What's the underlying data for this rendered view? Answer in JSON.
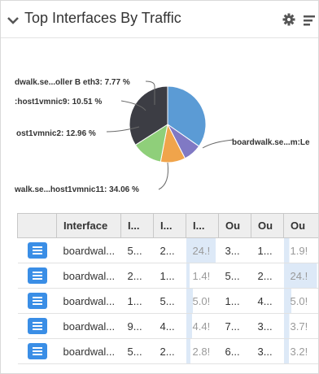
{
  "widget": {
    "title": "Top Interfaces By Traffic"
  },
  "pie": {
    "labels": [
      "boardwalk.se...m:Le",
      "dwalk.se...oller B eth3: 7.77 %",
      ":host1vmnic9: 10.51 %",
      "ost1vmnic2: 12.96 %",
      "walk.se...host1vmnic11: 34.06 %"
    ],
    "slices": [
      {
        "name": "boardwalk.se...m:Le",
        "value": 34.7,
        "color": "#5b9bd5"
      },
      {
        "name": "dwalk.se...oller B eth3",
        "value": 7.77,
        "color": "#8079c4"
      },
      {
        "name": ":host1vmnic9",
        "value": 10.51,
        "color": "#f0a44b"
      },
      {
        "name": "ost1vmnic2",
        "value": 12.96,
        "color": "#8fcf7a"
      },
      {
        "name": "walk.se...host1vmnic11",
        "value": 34.06,
        "color": "#3c3d44"
      }
    ]
  },
  "table": {
    "columns": [
      "",
      "Interface",
      "I...",
      "I...",
      "I...",
      "Ou",
      "Ou",
      "Ou"
    ],
    "rows": [
      {
        "cells": [
          "boardwal...",
          "5...",
          "2...",
          "24.!",
          "3...",
          "1...",
          "1.9!"
        ],
        "bar1": 0.9,
        "bar2": 0.15
      },
      {
        "cells": [
          "boardwal...",
          "2...",
          "1...",
          "1.4!",
          "5...",
          "2...",
          "24.!"
        ],
        "bar1": 0.1,
        "bar2": 0.9
      },
      {
        "cells": [
          "boardwal...",
          "1...",
          "5...",
          "5.0!",
          "1...",
          "4...",
          "5.0!"
        ],
        "bar1": 0.2,
        "bar2": 0.2
      },
      {
        "cells": [
          "boardwal...",
          "9...",
          "4...",
          "4.4!",
          "7...",
          "3...",
          "3.7!"
        ],
        "bar1": 0.18,
        "bar2": 0.15
      },
      {
        "cells": [
          "boardwal...",
          "5...",
          "2...",
          "2.8!",
          "6...",
          "3...",
          "3.2!"
        ],
        "bar1": 0.12,
        "bar2": 0.13
      }
    ]
  }
}
